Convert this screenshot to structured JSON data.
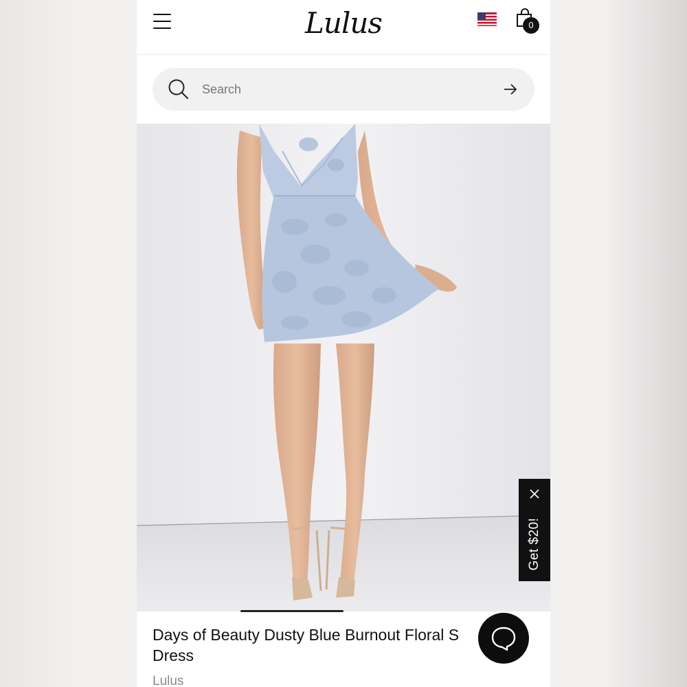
{
  "header": {
    "logo_text": "Lulus",
    "cart_count": "0"
  },
  "search": {
    "placeholder": "Search"
  },
  "promo": {
    "label": "Get $20!"
  },
  "product": {
    "title": "Days of Beauty Dusty Blue Burnout Floral S Dress",
    "brand": "Lulus"
  },
  "icons": [
    "menu-icon",
    "flag-icon",
    "cart-icon",
    "search-icon",
    "arrow-right-icon",
    "close-icon",
    "chat-icon"
  ],
  "colors": {
    "accent": "#111111",
    "dress": "#b8c8e0",
    "search_bg": "#f1f1f1"
  }
}
